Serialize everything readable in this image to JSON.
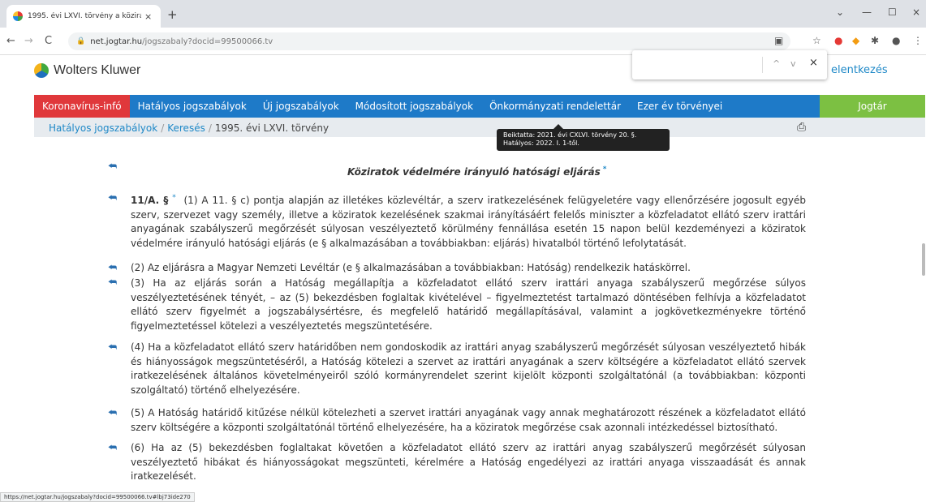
{
  "browser": {
    "tab_title": "1995. évi LXVI. törvény a közirato",
    "new_tab": "+",
    "close_tab": "×",
    "url_host": "net.jogtar.hu",
    "url_path": "/jogszabaly?docid=99500066.tv",
    "back": "←",
    "forward": "→",
    "reload": "C",
    "minimize": "—",
    "maximize": "☐",
    "close": "×",
    "tab_list": "⌄"
  },
  "site": {
    "logo_text": "Wolters Kluwer",
    "login_text": "elentkezés"
  },
  "findbar": {
    "value": "",
    "up": "^",
    "down": "v",
    "close": "×"
  },
  "nav": {
    "items": [
      "Koronavírus-infó",
      "Hatályos jogszabályok",
      "Új jogszabályok",
      "Módosított jogszabályok",
      "Önkormányzati rendelettár",
      "Ezer év törvényei"
    ],
    "right": "Jogtár"
  },
  "breadcrumb": {
    "items": [
      "Hatályos jogszabályok",
      "Keresés",
      "1995. évi LXVI. törvény"
    ],
    "separator": "/"
  },
  "tooltip": {
    "line1": "Beiktatta: 2021. évi CXLVI. törvény 20. §.",
    "line2": "Hatályos: 2022. I. 1-től."
  },
  "content": {
    "section_title": "Köziratok védelmére irányuló hatósági eljárás",
    "footnote_star": "*",
    "para1_num": "11/A. §",
    "para1": "  (1) A 11. § c) pontja alapján az illetékes közlevéltár, a szerv iratkezelésének felügyeletére vagy ellenőrzésére jogosult egyéb szerv, szervezet vagy személy, illetve a köziratok kezelésének szakmai irányításáért felelős miniszter a közfeladatot ellátó szerv irattári anyagának szabályszerű megőrzését súlyosan veszélyeztető körülmény fennállása esetén 15 napon belül kezdeményezi a köziratok védelmére irányuló hatósági eljárás (e § alkalmazásában a továbbiakban: eljárás) hivatalból történő lefolytatását.",
    "para2": "(2) Az eljárásra a Magyar Nemzeti Levéltár (e § alkalmazásában a továbbiakban: Hatóság) rendelkezik hatáskörrel.",
    "para3": "(3) Ha az eljárás során a Hatóság megállapítja a közfeladatot ellátó szerv irattári anyaga szabályszerű megőrzése súlyos veszélyeztetésének tényét, – az (5) bekezdésben foglaltak kivételével – figyelmeztetést tartalmazó döntésében felhívja a közfeladatot ellátó szerv figyelmét a jogszabálysértésre, és megfelelő határidő megállapításával, valamint a jogkövetkezményekre történő figyelmeztetéssel kötelezi a veszélyeztetés megszüntetésére.",
    "para4": "(4) Ha a közfeladatot ellátó szerv határidőben nem gondoskodik az irattári anyag szabályszerű megőrzését súlyosan veszélyeztető hibák és hiányosságok megszüntetéséről, a Hatóság kötelezi a szervet az irattári anyagának a szerv költségére a közfeladatot ellátó szervek iratkezelésének általános követelményeiről szóló kormányrendelet szerint kijelölt központi szolgáltatónál (a továbbiakban: központi szolgáltató) történő elhelyezésére.",
    "para5": "(5) A Hatóság határidő kitűzése nélkül kötelezheti a szervet irattári anyagának vagy annak meghatározott részének a közfeladatot ellátó szerv költségére a központi szolgáltatónál történő elhelyezésére, ha a köziratok megőrzése csak azonnali intézkedéssel biztosítható.",
    "para6": "(6) Ha az (5) bekezdésben foglaltakat követően a közfeladatot ellátó szerv az irattári anyag szabályszerű megőrzését súlyosan veszélyeztető hibákat és hiányosságokat megszünteti, kérelmére a Hatóság engedélyezi az irattári anyaga visszaadását és annak iratkezelését."
  },
  "status_url": "https://net.jogtar.hu/jogszabaly?docid=99500066.tv#lbj73ide270"
}
